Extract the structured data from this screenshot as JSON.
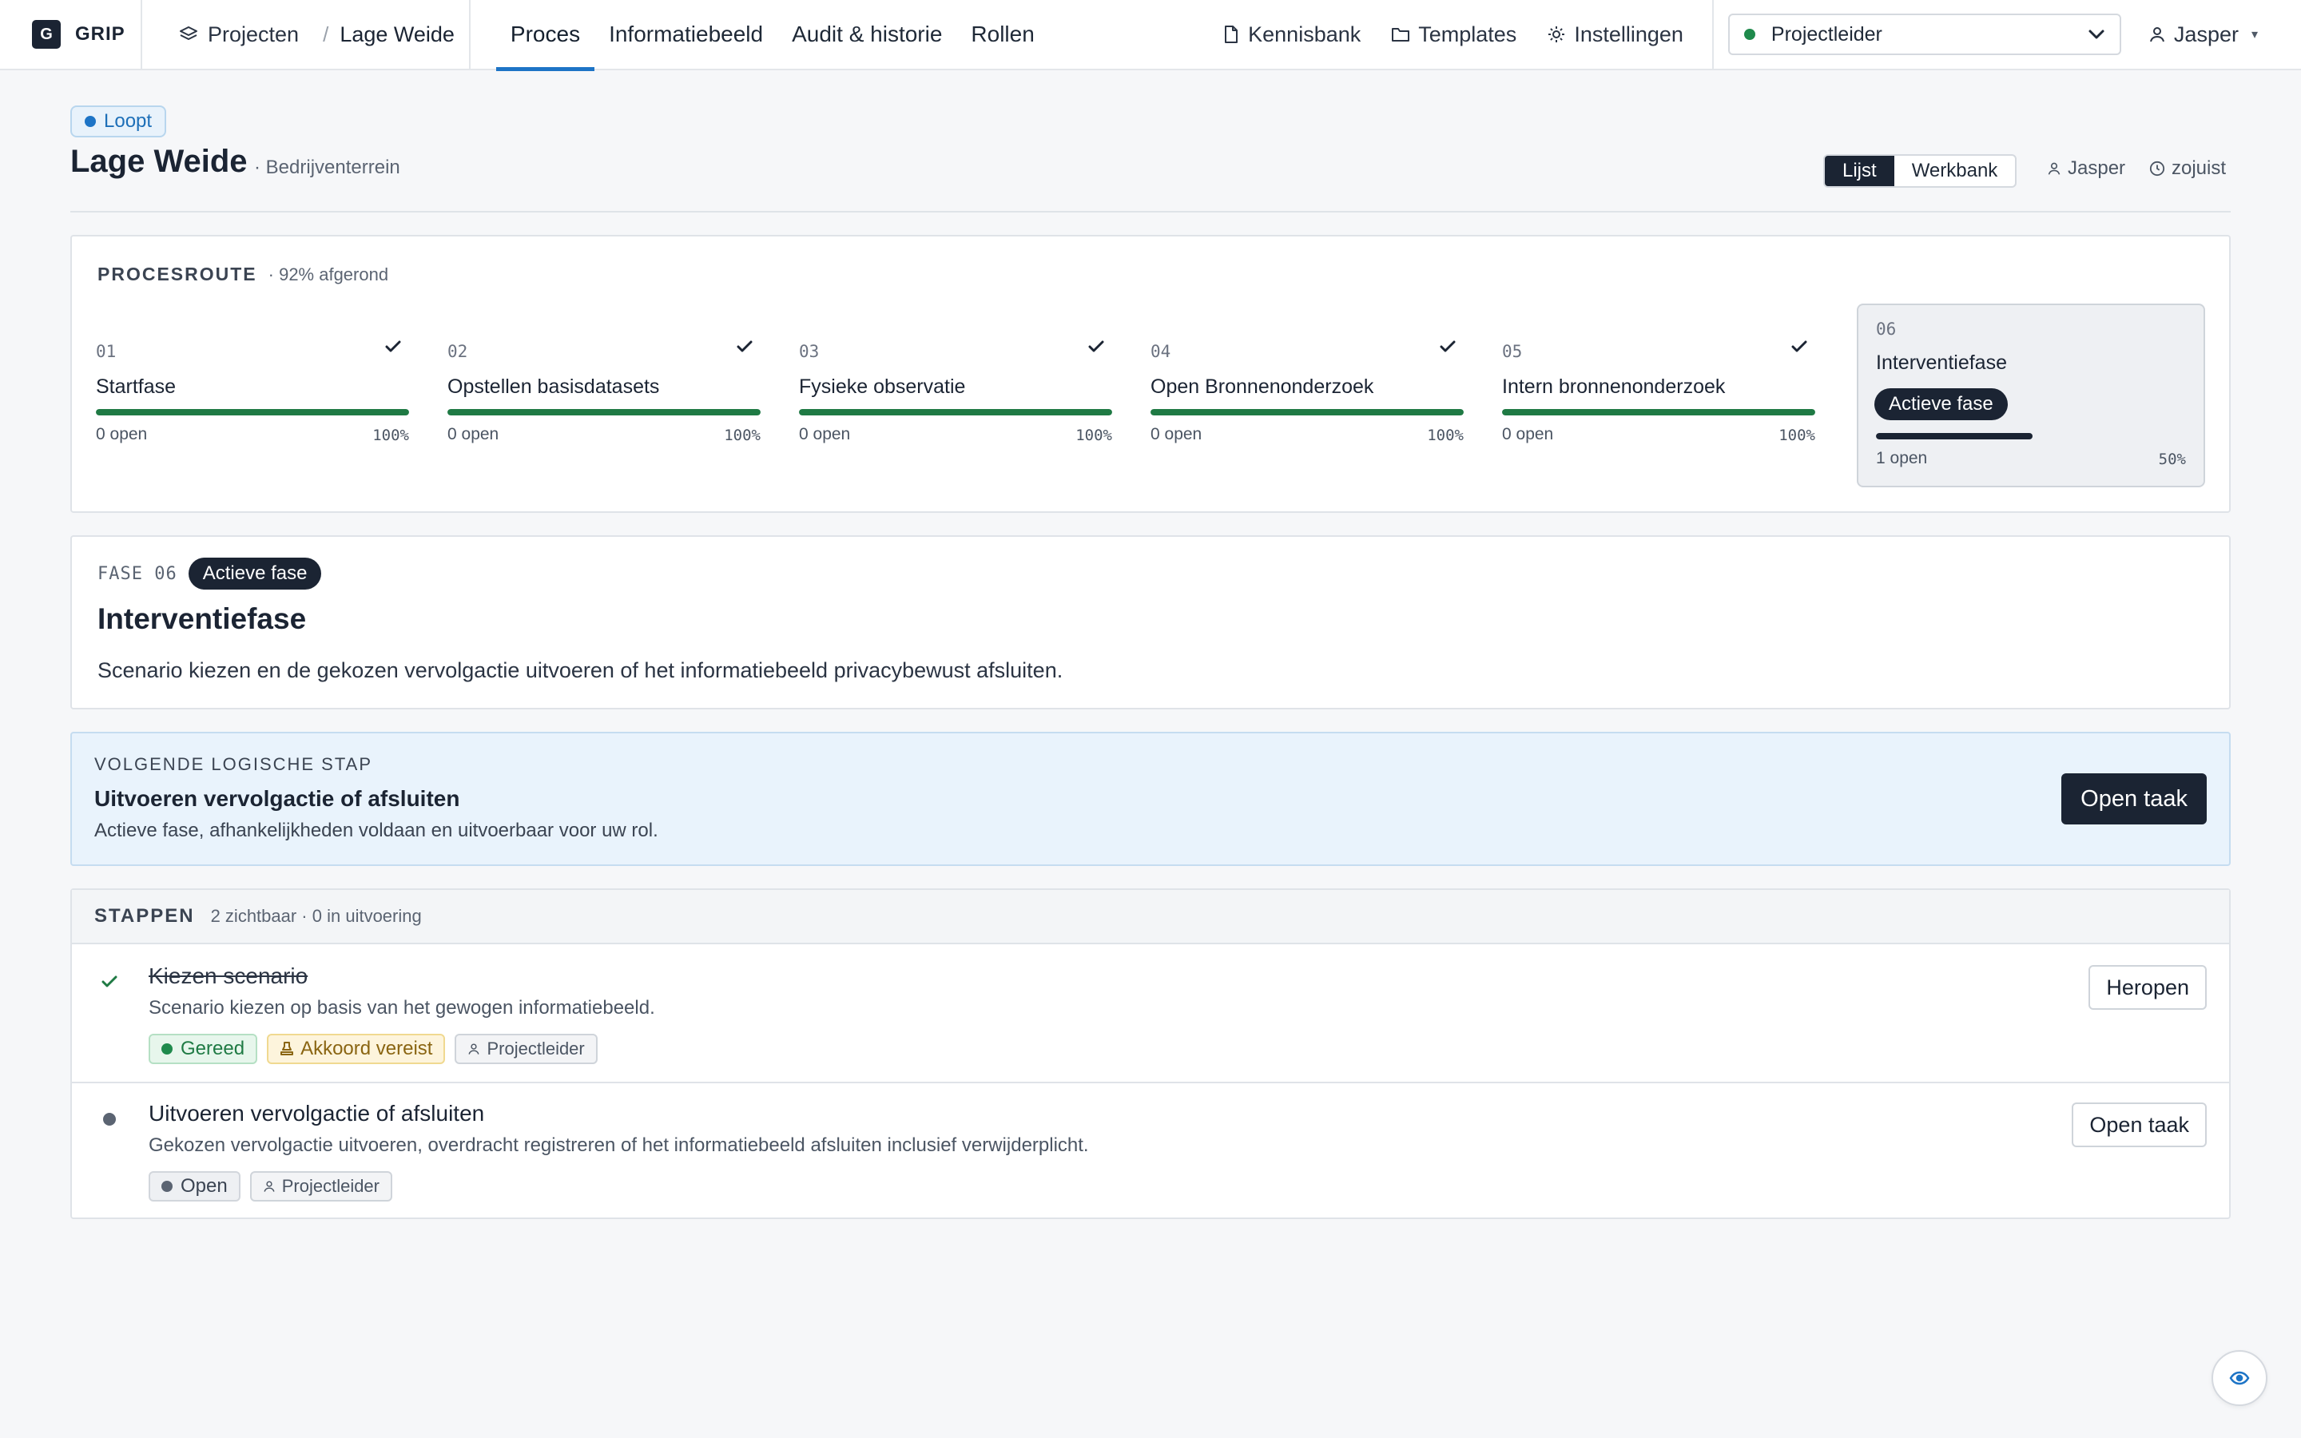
{
  "brand": {
    "mark": "G",
    "name": "GRIP"
  },
  "breadcrumb": {
    "projects_label": "Projecten",
    "separator": "/",
    "current": "Lage Weide"
  },
  "tabs": [
    {
      "label": "Proces",
      "active": true
    },
    {
      "label": "Informatiebeeld",
      "active": false
    },
    {
      "label": "Audit & historie",
      "active": false
    },
    {
      "label": "Rollen",
      "active": false
    }
  ],
  "top_links": [
    {
      "label": "Kennisbank",
      "icon": "document-icon"
    },
    {
      "label": "Templates",
      "icon": "folder-icon"
    },
    {
      "label": "Instellingen",
      "icon": "gear-icon"
    }
  ],
  "role_select": {
    "value": "Projectleider",
    "dot_color": "#1f8a4c"
  },
  "user": {
    "name": "Jasper",
    "caret": "▾"
  },
  "header": {
    "status": "Loopt",
    "title": "Lage Weide",
    "subtitle": "· Bedrijventerrein",
    "view_toggle": [
      "Lijst",
      "Werkbank"
    ],
    "view_active": "Lijst",
    "meta_user": "Jasper",
    "meta_time": "zojuist"
  },
  "process_route": {
    "label": "PROCESROUTE",
    "summary": "· 92% afgerond",
    "phases": [
      {
        "num": "01",
        "name": "Startfase",
        "open": "0 open",
        "pct": "100%",
        "progress": 1.0,
        "done": true
      },
      {
        "num": "02",
        "name": "Opstellen basisdatasets",
        "open": "0 open",
        "pct": "100%",
        "progress": 1.0,
        "done": true
      },
      {
        "num": "03",
        "name": "Fysieke observatie",
        "open": "0 open",
        "pct": "100%",
        "progress": 1.0,
        "done": true
      },
      {
        "num": "04",
        "name": "Open Bronnenonderzoek",
        "open": "0 open",
        "pct": "100%",
        "progress": 1.0,
        "done": true
      },
      {
        "num": "05",
        "name": "Intern bronnenonderzoek",
        "open": "0 open",
        "pct": "100%",
        "progress": 1.0,
        "done": true
      },
      {
        "num": "06",
        "name": "Interventiefase",
        "open": "1 open",
        "pct": "50%",
        "progress": 0.5,
        "done": false,
        "badge": "Actieve fase"
      }
    ]
  },
  "phase_detail": {
    "label": "FASE",
    "num": "06",
    "badge": "Actieve fase",
    "title": "Interventiefase",
    "description": "Scenario kiezen en de gekozen vervolgactie uitvoeren of het informatiebeeld privacybewust afsluiten."
  },
  "next_step": {
    "label": "VOLGENDE LOGISCHE STAP",
    "title": "Uitvoeren vervolgactie of afsluiten",
    "description": "Actieve fase, afhankelijkheden voldaan en uitvoerbaar voor uw rol.",
    "button": "Open taak"
  },
  "steps": {
    "label": "STAPPEN",
    "summary": "2 zichtbaar · 0 in uitvoering",
    "items": [
      {
        "title": "Kiezen scenario",
        "description": "Scenario kiezen op basis van het gewogen informatiebeeld.",
        "status": "Gereed",
        "approval": "Akkoord vereist",
        "role": "Projectleider",
        "button": "Heropen"
      },
      {
        "title": "Uitvoeren vervolgactie of afsluiten",
        "description": "Gekozen vervolgactie uitvoeren, overdracht registreren of het informatiebeeld afsluiten inclusief verwijderplicht.",
        "status": "Open",
        "role": "Projectleider",
        "button": "Open taak"
      }
    ]
  },
  "colors": {
    "accent": "#1d74c6",
    "dark": "#1b2433",
    "success": "#1f7a44"
  }
}
